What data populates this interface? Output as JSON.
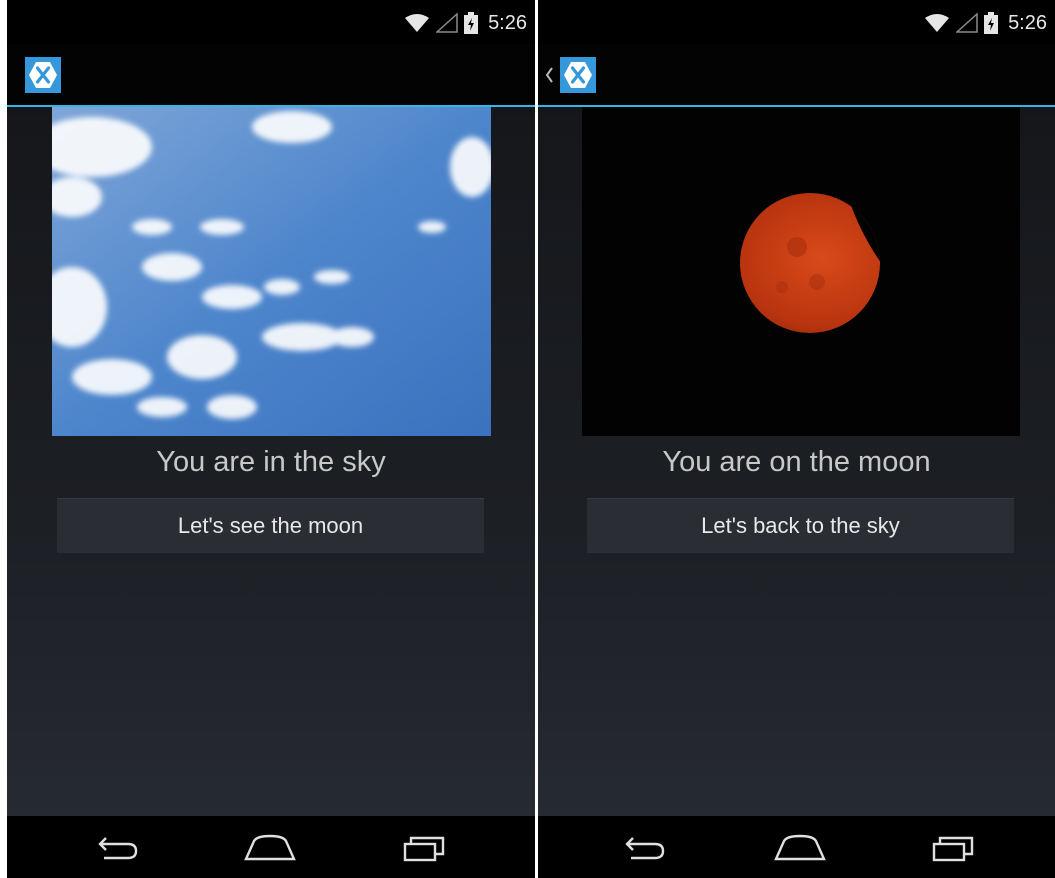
{
  "colors": {
    "accent": "#33b5e5",
    "xamarin_blue": "#3498db",
    "status_bar": "#000000",
    "button_bg": "#2a2e34",
    "moon_orange": "#c23a12"
  },
  "screens": [
    {
      "id": "sky",
      "status_time": "5:26",
      "icons": [
        "wifi-icon",
        "signal-icon",
        "battery-icon",
        "xamarin-logo-icon"
      ],
      "image_alt": "sky-photo",
      "caption": "You are in the sky",
      "button_label": "Let's see the moon",
      "nav": [
        "back-icon",
        "home-icon",
        "recents-icon"
      ]
    },
    {
      "id": "moon",
      "status_time": "5:26",
      "icons": [
        "wifi-icon",
        "signal-icon",
        "battery-icon",
        "up-caret-icon",
        "xamarin-logo-icon"
      ],
      "image_alt": "moon-photo",
      "caption": "You are on the moon",
      "button_label": "Let's back to the sky",
      "nav": [
        "back-icon",
        "home-icon",
        "recents-icon"
      ]
    }
  ]
}
